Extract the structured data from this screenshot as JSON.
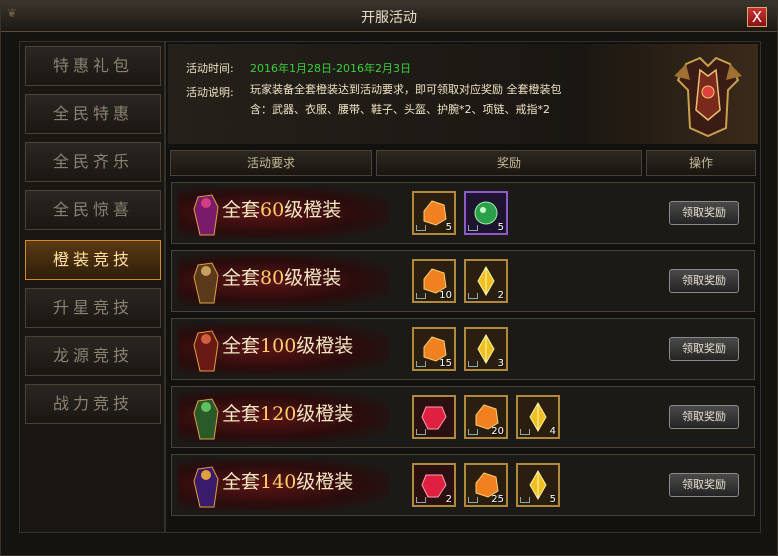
{
  "window": {
    "title": "开服活动",
    "close_label": "X"
  },
  "sidebar": {
    "items": [
      {
        "label": "特惠礼包",
        "active": false
      },
      {
        "label": "全民特惠",
        "active": false
      },
      {
        "label": "全民齐乐",
        "active": false
      },
      {
        "label": "全民惊喜",
        "active": false
      },
      {
        "label": "橙装竞技",
        "active": true
      },
      {
        "label": "升星竞技",
        "active": false
      },
      {
        "label": "龙源竞技",
        "active": false
      },
      {
        "label": "战力竞技",
        "active": false
      }
    ]
  },
  "banner": {
    "time_label": "活动时间:",
    "time_value": "2016年1月28日-2016年2月3日",
    "desc_label": "活动说明:",
    "desc_line1": "玩家装备全套橙装达到活动要求，即可领取对应奖励 全套橙装包",
    "desc_line2": "含：武器、衣服、腰带、鞋子、头盔、护腕*2、项链、戒指*2"
  },
  "headers": {
    "requirement": "活动要求",
    "reward": "奖励",
    "action": "操作"
  },
  "rows": [
    {
      "prefix": "全套",
      "level": "60",
      "suffix": "级橙装",
      "button": "领取奖励",
      "items": [
        {
          "icon": "orange-ore-icon",
          "count": "5"
        },
        {
          "icon": "green-gem-icon",
          "count": "5"
        }
      ]
    },
    {
      "prefix": "全套",
      "level": "80",
      "suffix": "级橙装",
      "button": "领取奖励",
      "items": [
        {
          "icon": "orange-ore-icon",
          "count": "10"
        },
        {
          "icon": "gold-crystal-icon",
          "count": "2"
        }
      ]
    },
    {
      "prefix": "全套",
      "level": "100",
      "suffix": "级橙装",
      "button": "领取奖励",
      "items": [
        {
          "icon": "orange-ore-icon",
          "count": "15"
        },
        {
          "icon": "gold-crystal-icon",
          "count": "3"
        }
      ]
    },
    {
      "prefix": "全套",
      "level": "120",
      "suffix": "级橙装",
      "button": "领取奖励",
      "items": [
        {
          "icon": "red-gem-icon",
          "count": ""
        },
        {
          "icon": "orange-ore-icon",
          "count": "20"
        },
        {
          "icon": "gold-crystal-icon",
          "count": "4"
        }
      ]
    },
    {
      "prefix": "全套",
      "level": "140",
      "suffix": "级橙装",
      "button": "领取奖励",
      "items": [
        {
          "icon": "red-gem-icon",
          "count": "2"
        },
        {
          "icon": "orange-ore-icon",
          "count": "25"
        },
        {
          "icon": "gold-crystal-icon",
          "count": "5"
        }
      ]
    }
  ]
}
